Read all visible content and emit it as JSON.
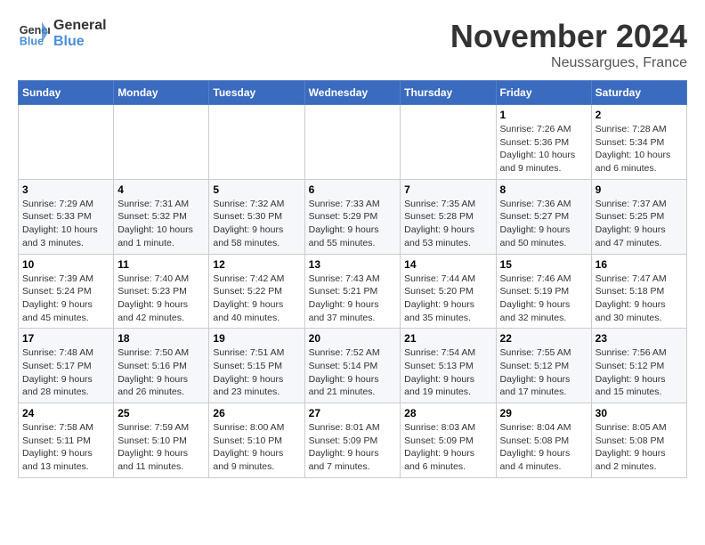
{
  "header": {
    "logo_line1": "General",
    "logo_line2": "Blue",
    "month_title": "November 2024",
    "location": "Neussargues, France"
  },
  "weekdays": [
    "Sunday",
    "Monday",
    "Tuesday",
    "Wednesday",
    "Thursday",
    "Friday",
    "Saturday"
  ],
  "weeks": [
    [
      {
        "day": "",
        "info": ""
      },
      {
        "day": "",
        "info": ""
      },
      {
        "day": "",
        "info": ""
      },
      {
        "day": "",
        "info": ""
      },
      {
        "day": "",
        "info": ""
      },
      {
        "day": "1",
        "info": "Sunrise: 7:26 AM\nSunset: 5:36 PM\nDaylight: 10 hours and 9 minutes."
      },
      {
        "day": "2",
        "info": "Sunrise: 7:28 AM\nSunset: 5:34 PM\nDaylight: 10 hours and 6 minutes."
      }
    ],
    [
      {
        "day": "3",
        "info": "Sunrise: 7:29 AM\nSunset: 5:33 PM\nDaylight: 10 hours and 3 minutes."
      },
      {
        "day": "4",
        "info": "Sunrise: 7:31 AM\nSunset: 5:32 PM\nDaylight: 10 hours and 1 minute."
      },
      {
        "day": "5",
        "info": "Sunrise: 7:32 AM\nSunset: 5:30 PM\nDaylight: 9 hours and 58 minutes."
      },
      {
        "day": "6",
        "info": "Sunrise: 7:33 AM\nSunset: 5:29 PM\nDaylight: 9 hours and 55 minutes."
      },
      {
        "day": "7",
        "info": "Sunrise: 7:35 AM\nSunset: 5:28 PM\nDaylight: 9 hours and 53 minutes."
      },
      {
        "day": "8",
        "info": "Sunrise: 7:36 AM\nSunset: 5:27 PM\nDaylight: 9 hours and 50 minutes."
      },
      {
        "day": "9",
        "info": "Sunrise: 7:37 AM\nSunset: 5:25 PM\nDaylight: 9 hours and 47 minutes."
      }
    ],
    [
      {
        "day": "10",
        "info": "Sunrise: 7:39 AM\nSunset: 5:24 PM\nDaylight: 9 hours and 45 minutes."
      },
      {
        "day": "11",
        "info": "Sunrise: 7:40 AM\nSunset: 5:23 PM\nDaylight: 9 hours and 42 minutes."
      },
      {
        "day": "12",
        "info": "Sunrise: 7:42 AM\nSunset: 5:22 PM\nDaylight: 9 hours and 40 minutes."
      },
      {
        "day": "13",
        "info": "Sunrise: 7:43 AM\nSunset: 5:21 PM\nDaylight: 9 hours and 37 minutes."
      },
      {
        "day": "14",
        "info": "Sunrise: 7:44 AM\nSunset: 5:20 PM\nDaylight: 9 hours and 35 minutes."
      },
      {
        "day": "15",
        "info": "Sunrise: 7:46 AM\nSunset: 5:19 PM\nDaylight: 9 hours and 32 minutes."
      },
      {
        "day": "16",
        "info": "Sunrise: 7:47 AM\nSunset: 5:18 PM\nDaylight: 9 hours and 30 minutes."
      }
    ],
    [
      {
        "day": "17",
        "info": "Sunrise: 7:48 AM\nSunset: 5:17 PM\nDaylight: 9 hours and 28 minutes."
      },
      {
        "day": "18",
        "info": "Sunrise: 7:50 AM\nSunset: 5:16 PM\nDaylight: 9 hours and 26 minutes."
      },
      {
        "day": "19",
        "info": "Sunrise: 7:51 AM\nSunset: 5:15 PM\nDaylight: 9 hours and 23 minutes."
      },
      {
        "day": "20",
        "info": "Sunrise: 7:52 AM\nSunset: 5:14 PM\nDaylight: 9 hours and 21 minutes."
      },
      {
        "day": "21",
        "info": "Sunrise: 7:54 AM\nSunset: 5:13 PM\nDaylight: 9 hours and 19 minutes."
      },
      {
        "day": "22",
        "info": "Sunrise: 7:55 AM\nSunset: 5:12 PM\nDaylight: 9 hours and 17 minutes."
      },
      {
        "day": "23",
        "info": "Sunrise: 7:56 AM\nSunset: 5:12 PM\nDaylight: 9 hours and 15 minutes."
      }
    ],
    [
      {
        "day": "24",
        "info": "Sunrise: 7:58 AM\nSunset: 5:11 PM\nDaylight: 9 hours and 13 minutes."
      },
      {
        "day": "25",
        "info": "Sunrise: 7:59 AM\nSunset: 5:10 PM\nDaylight: 9 hours and 11 minutes."
      },
      {
        "day": "26",
        "info": "Sunrise: 8:00 AM\nSunset: 5:10 PM\nDaylight: 9 hours and 9 minutes."
      },
      {
        "day": "27",
        "info": "Sunrise: 8:01 AM\nSunset: 5:09 PM\nDaylight: 9 hours and 7 minutes."
      },
      {
        "day": "28",
        "info": "Sunrise: 8:03 AM\nSunset: 5:09 PM\nDaylight: 9 hours and 6 minutes."
      },
      {
        "day": "29",
        "info": "Sunrise: 8:04 AM\nSunset: 5:08 PM\nDaylight: 9 hours and 4 minutes."
      },
      {
        "day": "30",
        "info": "Sunrise: 8:05 AM\nSunset: 5:08 PM\nDaylight: 9 hours and 2 minutes."
      }
    ]
  ]
}
